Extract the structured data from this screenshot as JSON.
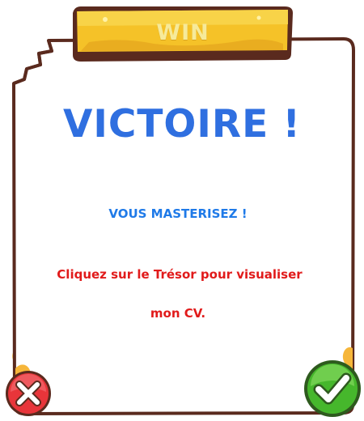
{
  "banner": {
    "label": "WIN"
  },
  "dialog": {
    "title": "VICTOIRE !",
    "subtitle": "VOUS MASTERISEZ !",
    "message_line1": "Cliquez sur le Trésor pour visualiser",
    "message_line2": "mon CV."
  },
  "buttons": {
    "cancel": {
      "icon": "close-icon",
      "color": "#e8353a"
    },
    "confirm": {
      "icon": "checkmark-icon",
      "color": "#46b72c"
    }
  },
  "colors": {
    "title": "#2f6fe0",
    "subtitle": "#1f7ae8",
    "message": "#e11b1b",
    "banner": "#f5c228",
    "panel_border": "#5a2a1e",
    "splatter": "#f6b63a"
  }
}
